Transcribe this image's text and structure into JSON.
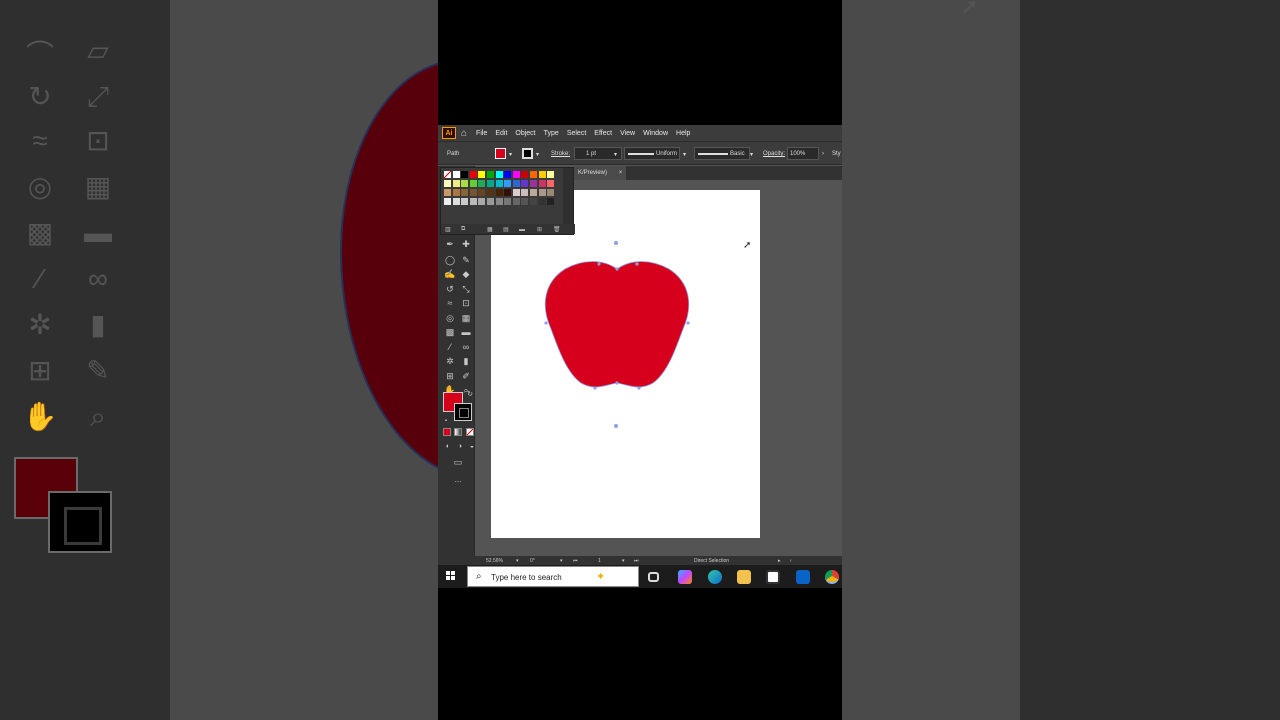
{
  "app": {
    "logo_text": "Ai",
    "menu": [
      "File",
      "Edit",
      "Object",
      "Type",
      "Select",
      "Effect",
      "View",
      "Window",
      "Help"
    ]
  },
  "control_bar": {
    "selection_label": "Path",
    "stroke_label": "Stroke:",
    "stroke_weight": "1 pt",
    "profile": "Uniform",
    "brush": "Basic",
    "opacity_label": "Opacity:",
    "opacity_value": "100%",
    "style_label": "Sty"
  },
  "document_tab": {
    "title": "K/Preview)",
    "close": "×"
  },
  "colors": {
    "apple_fill": "#d6001c",
    "path_outline": "#8aa2e8",
    "ui_dark": "#323232",
    "canvas": "#545454"
  },
  "toolbar": {
    "more_label": "..."
  },
  "status_bar": {
    "zoom": "52.56%",
    "rotation": "0°",
    "artboard_number": "1",
    "active_tool": "Direct Selection"
  },
  "taskbar": {
    "search_placeholder": "Type here to search"
  }
}
